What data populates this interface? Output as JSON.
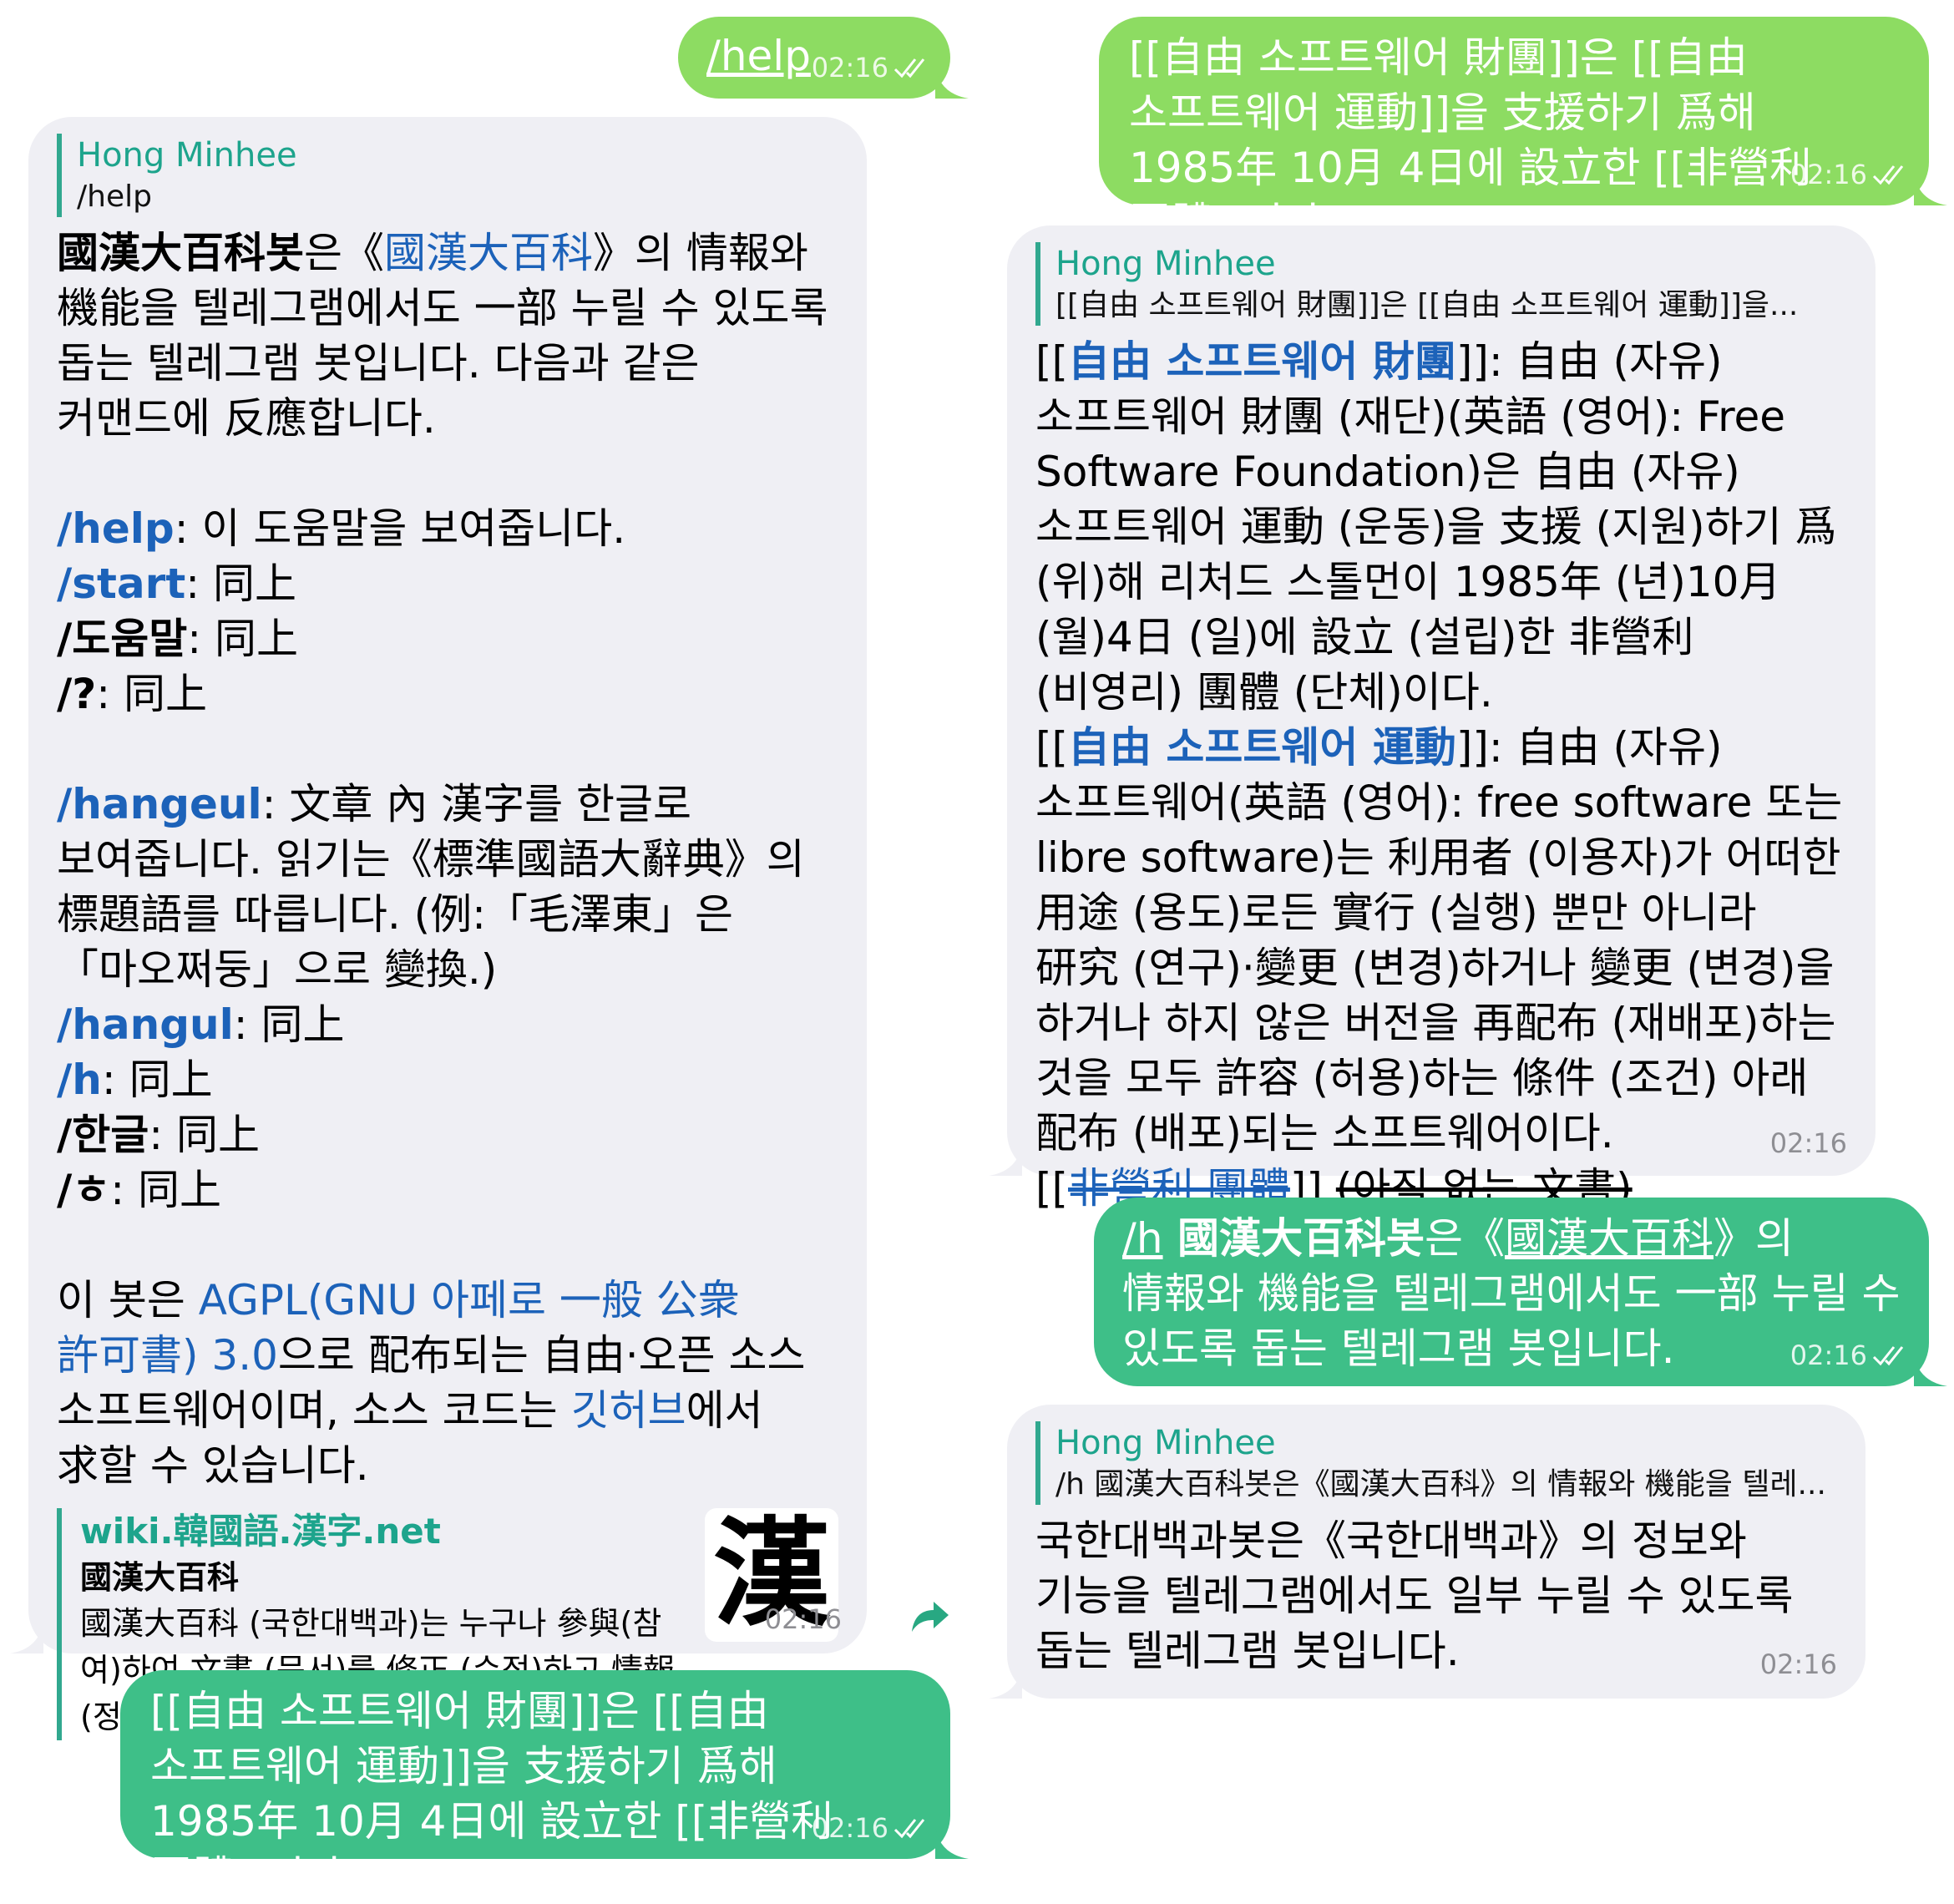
{
  "colors": {
    "out_light": "#8ddc62",
    "out_dark": "#3ebf88",
    "incoming": "#efeff4",
    "link": "#1c62b9",
    "reply_accent": "#31a88f"
  },
  "left": {
    "m1": {
      "text": "/help",
      "time": "02:16"
    },
    "m2": {
      "reply_name": "Hong Minhee",
      "reply_text": "/help",
      "intro_b": "國漢大百科봇",
      "intro_1": "은《",
      "intro_link": "國漢大百科",
      "intro_2": "》의 情報와 機能을 텔레그램에서도 一部 누릴 수 있도록 돕는 텔레그램 봇입니다.  다음과 같은 커맨드에 反應합니다.",
      "cmds1": [
        {
          "cmd": "/help",
          "desc": ": 이 도움말을 보여줍니다.",
          "link": true
        },
        {
          "cmd": "/start",
          "desc": ": 同上",
          "link": true
        },
        {
          "cmd": "/도움말",
          "desc": ": 同上",
          "link": false
        },
        {
          "cmd": "/?",
          "desc": ": 同上",
          "link": false
        }
      ],
      "hangeul_cmd": "/hangeul",
      "hangeul_desc": ": 文章 內 漢字를 한글로 보여줍니다. 읽기는《標準國語大辭典》의 標題語를 따릅니다. (例:「毛澤東」은「마오쩌둥」으로 變換.)",
      "cmds2": [
        {
          "cmd": "/hangul",
          "desc": ": 同上",
          "link": true
        },
        {
          "cmd": "/h",
          "desc": ": 同上",
          "link": true
        },
        {
          "cmd": "/한글",
          "desc": ": 同上",
          "link": false
        },
        {
          "cmd": "/ㅎ",
          "desc": ": 同上",
          "link": false
        }
      ],
      "license_1": "이 봇은 ",
      "license_link": "AGPL(GNU 아페로 一般 公衆 許可書) 3.0",
      "license_2": "으로 配布되는 自由·오픈 소스 소프트웨어이며, 소스 코드는 ",
      "license_link2": "깃허브",
      "license_3": "에서 求할 수 있습니다.",
      "preview_site": "wiki.韓國語.漢字.net",
      "preview_title": "國漢大百科",
      "preview_desc": "國漢大百科 (국한대백과)는 누구나 參與(참여)하여 文書 (문서)를 修正 (수정)하고 情報 (정보)를 모아나가는 위키위키입니다.",
      "preview_logo": "漢",
      "time": "02:16"
    },
    "m3": {
      "text": "[[自由 소프트웨어 財團]]은 [[自由 소프트웨어 運動]]을 支援하기 爲해 1985年 10月 4日에 設立한 [[非營利 團體]]이다.",
      "time": "02:16"
    }
  },
  "right": {
    "m1": {
      "text": "[[自由 소프트웨어 財團]]은 [[自由 소프트웨어 運動]]을 支援하기 爲해 1985年 10月 4日에 設立한 [[非營利 團體]]이다.",
      "time": "02:16"
    },
    "m2": {
      "reply_name": "Hong Minhee",
      "reply_text": "[[自由 소프트웨어 財團]]은 [[自由 소프트웨어 運動]]을...",
      "p1_open": "[[",
      "p1_link": "自由 소프트웨어 財團",
      "p1_rest": "]]: 自由 (자유) 소프트웨어 財團 (재단)(英語 (영어): Free Software Foundation)은 自由 (자유) 소프트웨어 運動 (운동)을 支援 (지원)하기 爲 (위)해 리처드 스톨먼이 1985年 (년)10月 (월)4日 (일)에 設立 (설립)한 非營利 (비영리) 團體 (단체)이다.",
      "p2_open": "[[",
      "p2_link": "自由 소프트웨어 運動",
      "p2_rest": "]]: 自由 (자유) 소프트웨어(英語 (영어): free software 또는 libre software)는 利用者 (이용자)가 어떠한 用途 (용도)로든 實行 (실행) 뿐만 아니라 研究 (연구)·變更 (변경)하거나 變更 (변경)을 하거나 하지 않은 버전을 再配布 (재배포)하는 것을 모두 許容 (허용)하는 條件 (조건) 아래 配布 (배포)되는 소프트웨어이다.",
      "p3_open": "[[",
      "p3_link": "非營利 團體",
      "p3_close": "]] ",
      "p3_strike": "(아직 없는 文書)",
      "time": "02:16"
    },
    "m3": {
      "cmd": "/h",
      "bold": " 國漢大百科봇",
      "t1": "은《",
      "ul": "國漢大百科",
      "t2": "》의 情報와 機能을 텔레그램에서도 一部 누릴 수 있도록 돕는 텔레그램 봇입니다.",
      "time": "02:16"
    },
    "m4": {
      "reply_name": "Hong Minhee",
      "reply_text": "/h 國漢大百科봇은《國漢大百科》의 情報와 機能을 텔레...",
      "text": "국한대백과봇은《국한대백과》의 정보와 기능을 텔레그램에서도 일부 누릴 수 있도록 돕는 텔레그램 봇입니다.",
      "time": "02:16"
    }
  }
}
